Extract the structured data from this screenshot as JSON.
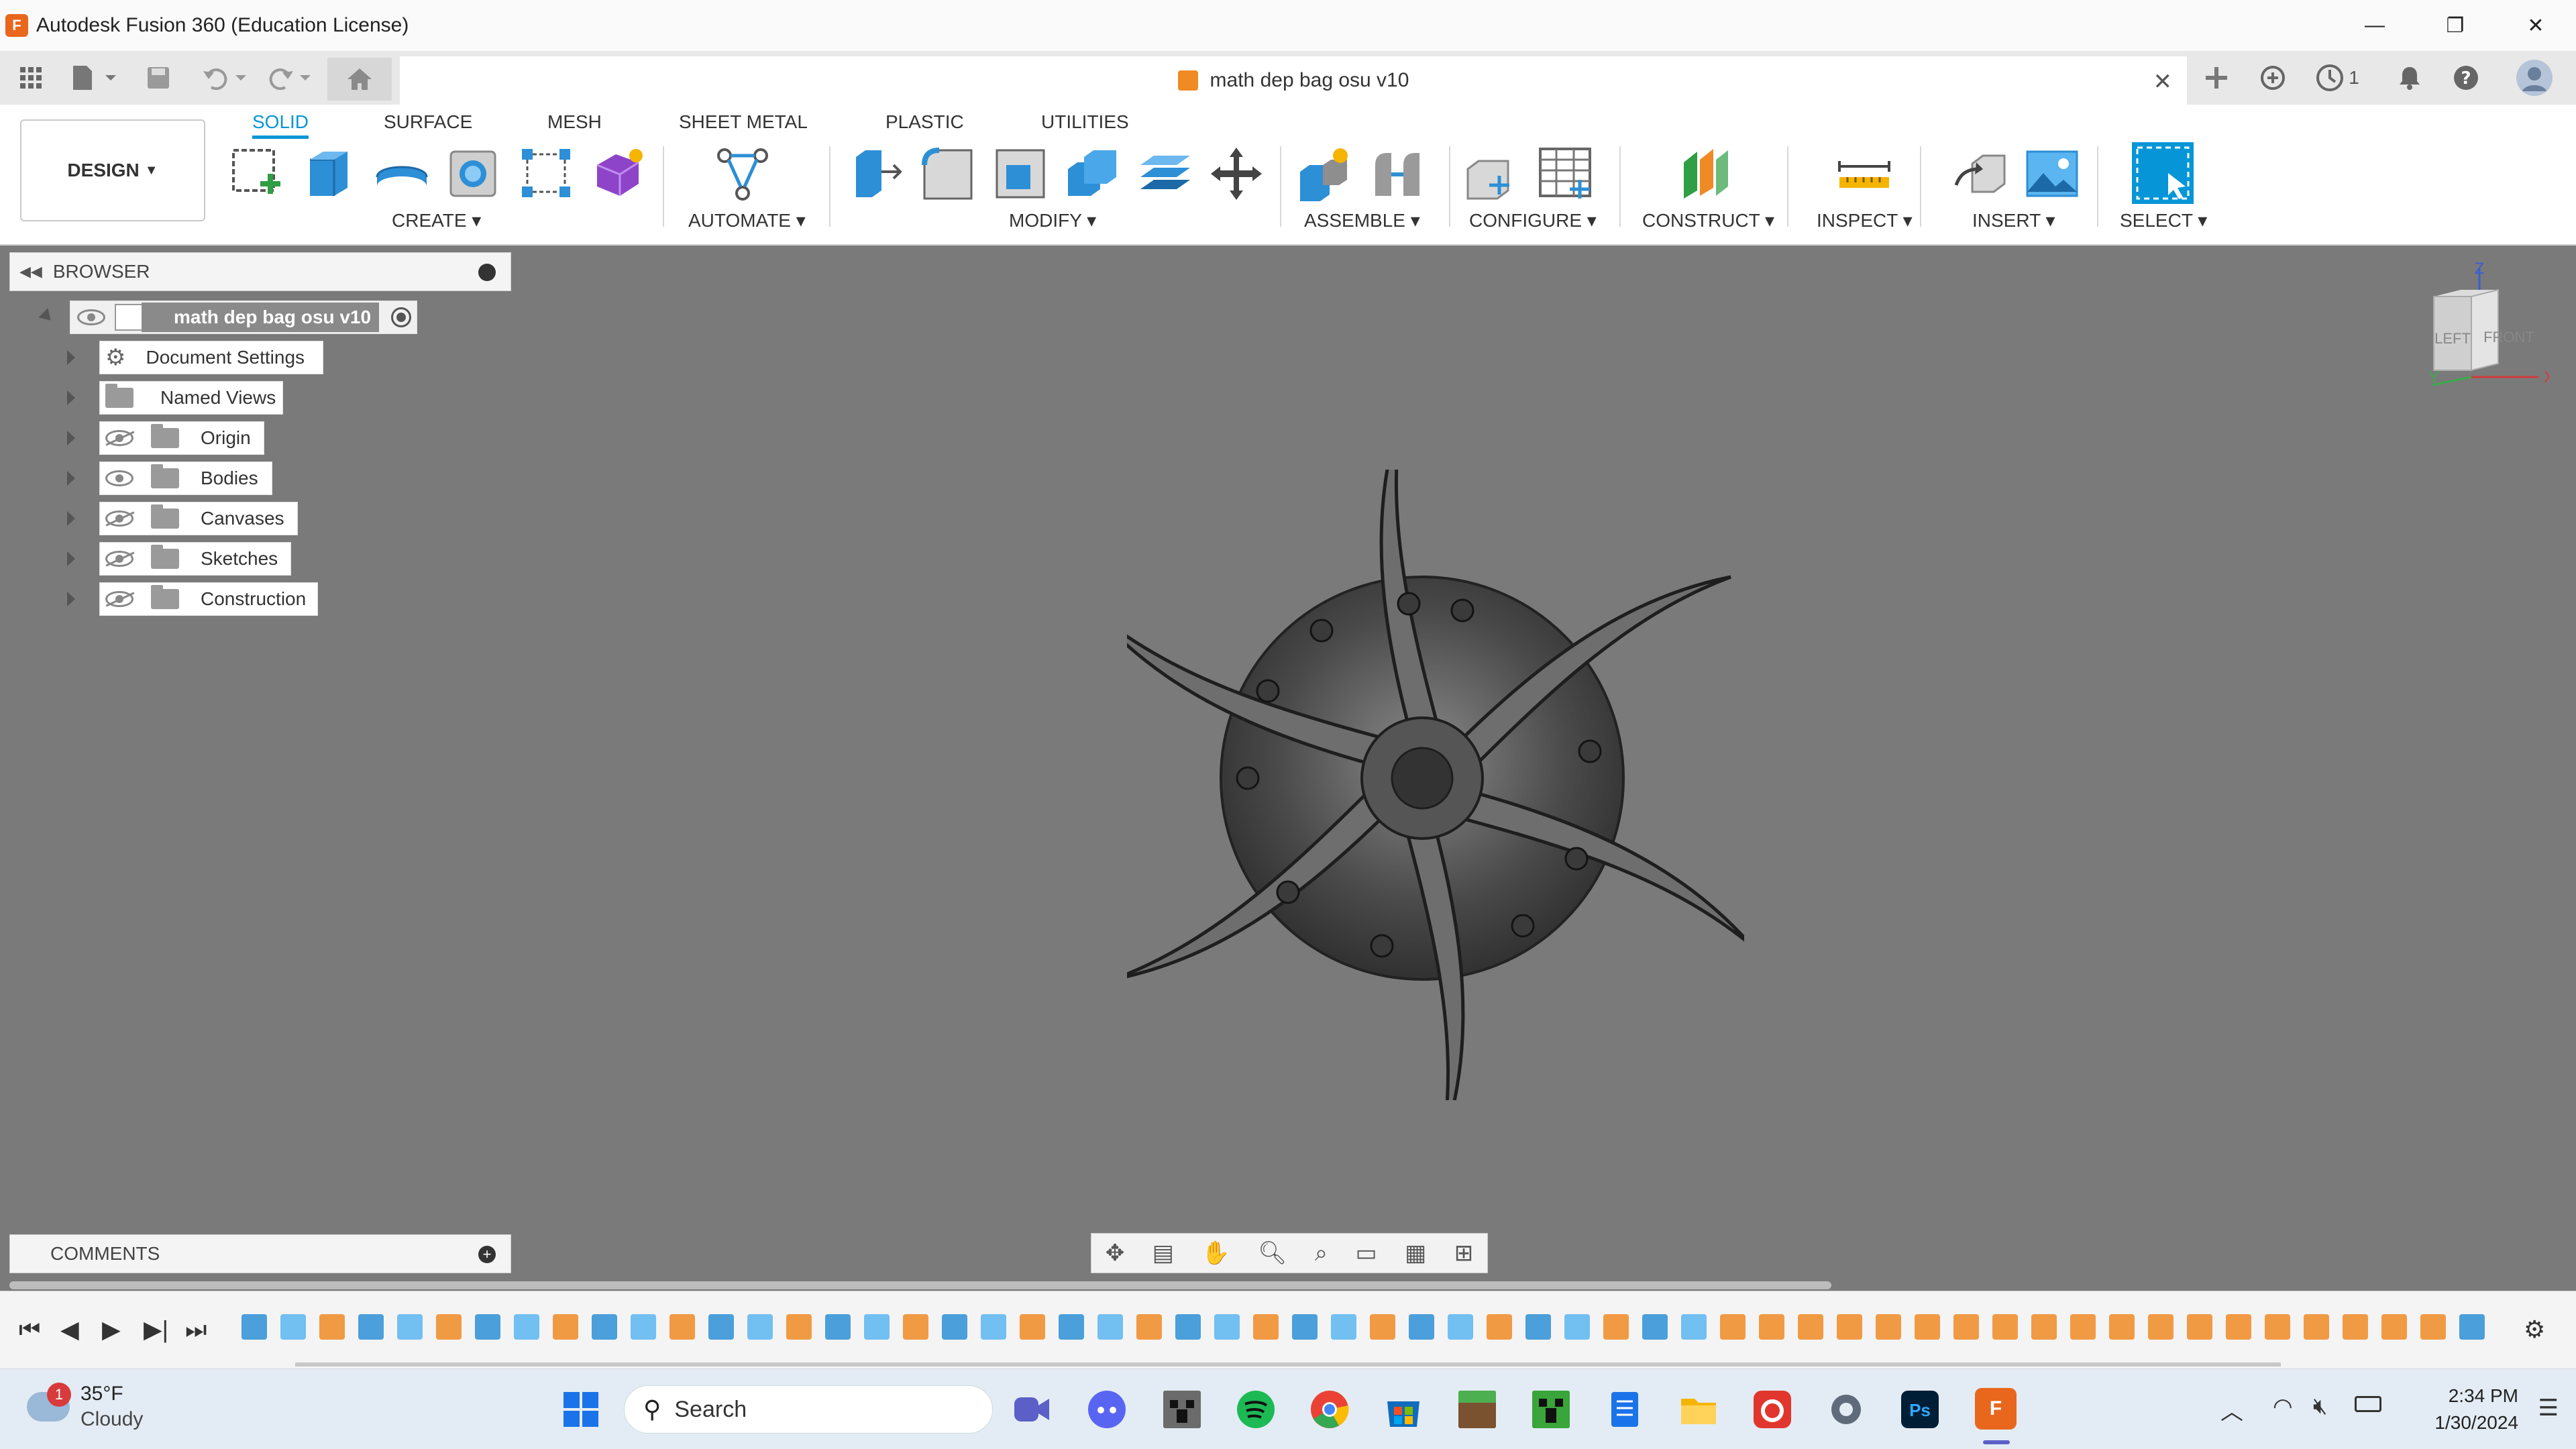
{
  "window": {
    "app_icon_letter": "F",
    "title": "Autodesk Fusion 360 (Education License)",
    "controls": {
      "minimize": "—",
      "restore": "❐",
      "close": "✕"
    }
  },
  "tabbar": {
    "document_name": "math dep bag osu v10",
    "close_glyph": "✕",
    "job_count": "1"
  },
  "toolbar": {
    "workspace": "DESIGN",
    "tabs": [
      "SOLID",
      "SURFACE",
      "MESH",
      "SHEET METAL",
      "PLASTIC",
      "UTILITIES"
    ],
    "groups": [
      "CREATE",
      "AUTOMATE",
      "MODIFY",
      "ASSEMBLE",
      "CONFIGURE",
      "CONSTRUCT",
      "INSPECT",
      "INSERT",
      "SELECT"
    ]
  },
  "browser": {
    "title": "BROWSER",
    "root": "math dep bag osu v10",
    "items": [
      "Document Settings",
      "Named Views",
      "Origin",
      "Bodies",
      "Canvases",
      "Sketches",
      "Construction"
    ]
  },
  "viewcube": {
    "left": "LEFT",
    "front": "FRONT",
    "z": "Z",
    "x": "X",
    "y": "Y"
  },
  "comments": {
    "title": "COMMENTS"
  },
  "taskbar": {
    "weather_badge": "1",
    "temperature": "35°F",
    "condition": "Cloudy",
    "search_placeholder": "Search",
    "time": "2:34 PM",
    "date": "1/30/2024"
  },
  "colors": {
    "accent": "#0696d7",
    "viewport": "#7a7a7a",
    "fusion_orange": "#e9671d"
  }
}
